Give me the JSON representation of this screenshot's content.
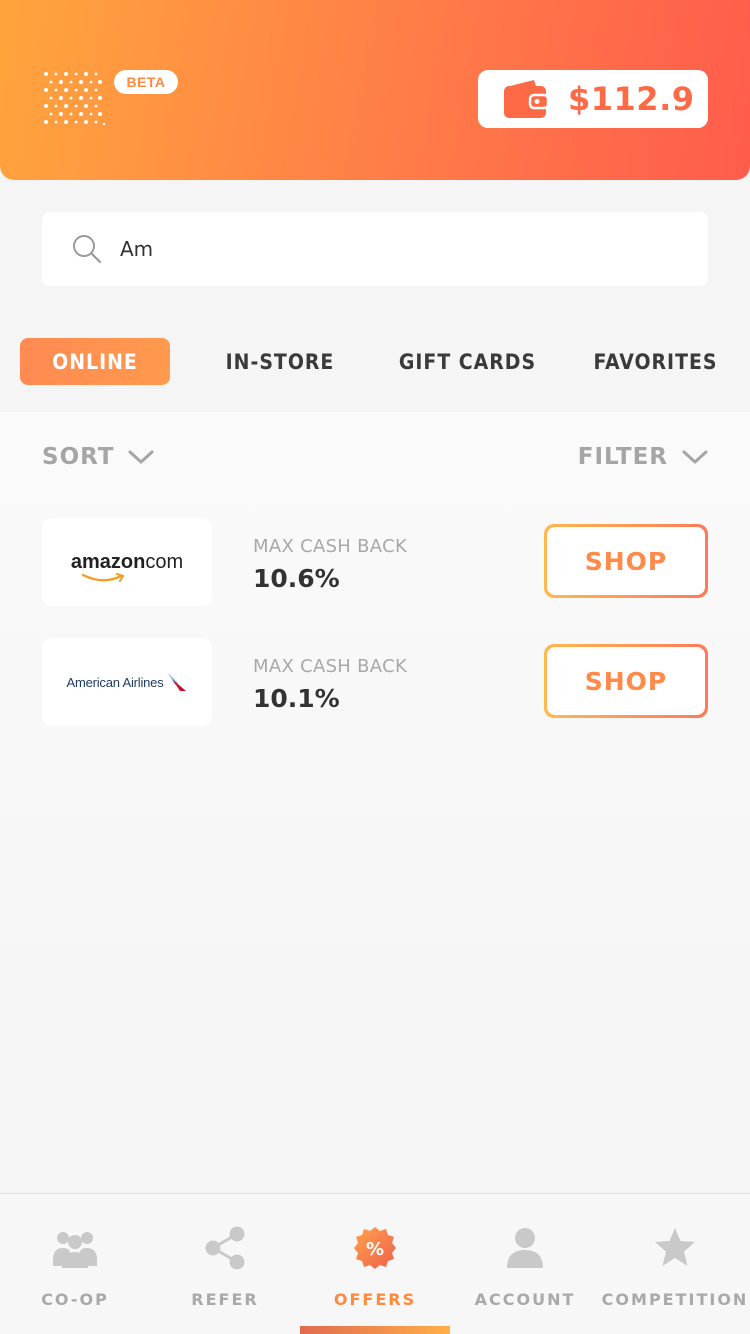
{
  "header": {
    "beta_label": "BETA",
    "balance": "$112.9",
    "balance_icon": "wallet-icon",
    "logo_icon": "sparkle-grid-logo"
  },
  "search": {
    "value": "Am",
    "placeholder": "",
    "icon": "search-icon"
  },
  "tabs": [
    {
      "label": "ONLINE",
      "active": true
    },
    {
      "label": "IN-STORE",
      "active": false
    },
    {
      "label": "GIFT CARDS",
      "active": false
    },
    {
      "label": "FAVORITES",
      "active": false
    }
  ],
  "controls": {
    "sort_label": "SORT",
    "filter_label": "FILTER"
  },
  "offers": [
    {
      "merchant": "amazon.com",
      "logo_text_a": "amazon",
      "logo_text_b": "com",
      "label": "MAX CASH BACK",
      "value": "10.6%",
      "button": "SHOP"
    },
    {
      "merchant": "American Airlines",
      "logo_text": "American Airlines",
      "label": "MAX CASH BACK",
      "value": "10.1%",
      "button": "SHOP"
    }
  ],
  "nav": [
    {
      "label": "CO-OP",
      "icon": "group-icon",
      "active": false
    },
    {
      "label": "REFER",
      "icon": "share-icon",
      "active": false
    },
    {
      "label": "OFFERS",
      "icon": "percent-badge-icon",
      "active": true
    },
    {
      "label": "ACCOUNT",
      "icon": "person-icon",
      "active": false
    },
    {
      "label": "COMPETITION",
      "icon": "star-icon",
      "active": false
    }
  ],
  "colors": {
    "accent": "#ff8a3e",
    "header_start": "#ffa53d",
    "header_end": "#ff5c4c",
    "balance": "#ff6a46"
  }
}
